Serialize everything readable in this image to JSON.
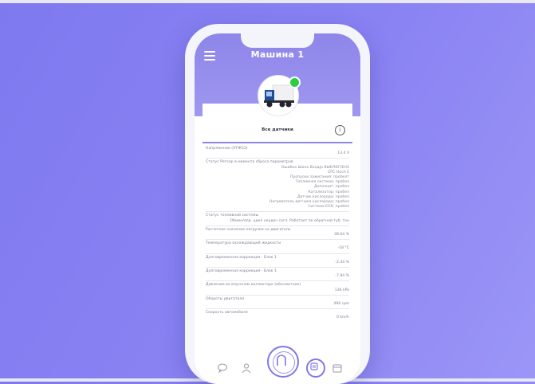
{
  "app": {
    "title": "Машина 1"
  },
  "section": {
    "title": "Все датчики"
  },
  "sensors": {
    "voltage_label": "Напряжение (ХТЖ53)",
    "voltage_value": "13.4 V",
    "status_label": "Статус Ретсор в момента сброса параметров",
    "status_lines": [
      "Ошибка Шина Вход/р ВЫКЛЮЧЕНА",
      "DTC Hoch E",
      "Пропуски зажигания: пробелт",
      "Топливная система: пробел",
      "Дополнит. пробел",
      "Катализатор: пробел",
      "Датчик кислорода: пробел",
      "Нагреватель датчика кислорода: пробел",
      "Система EGR: пробел"
    ],
    "fuel_system_label": "Статус топливной системы",
    "fuel_system_value": "Обмен/опр. цикл неудач согл. Работает по обратной туб. тон",
    "engine_load_label": "Расчетное значение нагрузки на двигатель",
    "engine_load_value": "38.04 %",
    "coolant_label": "Температура охлаждающей жидкости",
    "coolant_value": "-18 °C",
    "fuel_trim1_label": "Долговременная коррекция - Блок 1",
    "fuel_trim1_value": "-2.34 %",
    "fuel_trim2_label": "Долговременная коррекция - Блок 1",
    "fuel_trim2_value": "-7.94 %",
    "intake_label": "Давление во впускном коллекторе (абсолютное)",
    "intake_value": "136 kPa",
    "rpm_label": "Обороты двигателя",
    "rpm_value": "496 rpm",
    "speed_label": "Скорость автомобиля",
    "speed_value": "0 km/h"
  },
  "icons": {
    "menu": "menu-icon",
    "info": "info-icon",
    "truck": "truck-icon"
  },
  "colors": {
    "accent": "#8e85ea",
    "online": "#2ecc40",
    "background": "#847df1"
  }
}
